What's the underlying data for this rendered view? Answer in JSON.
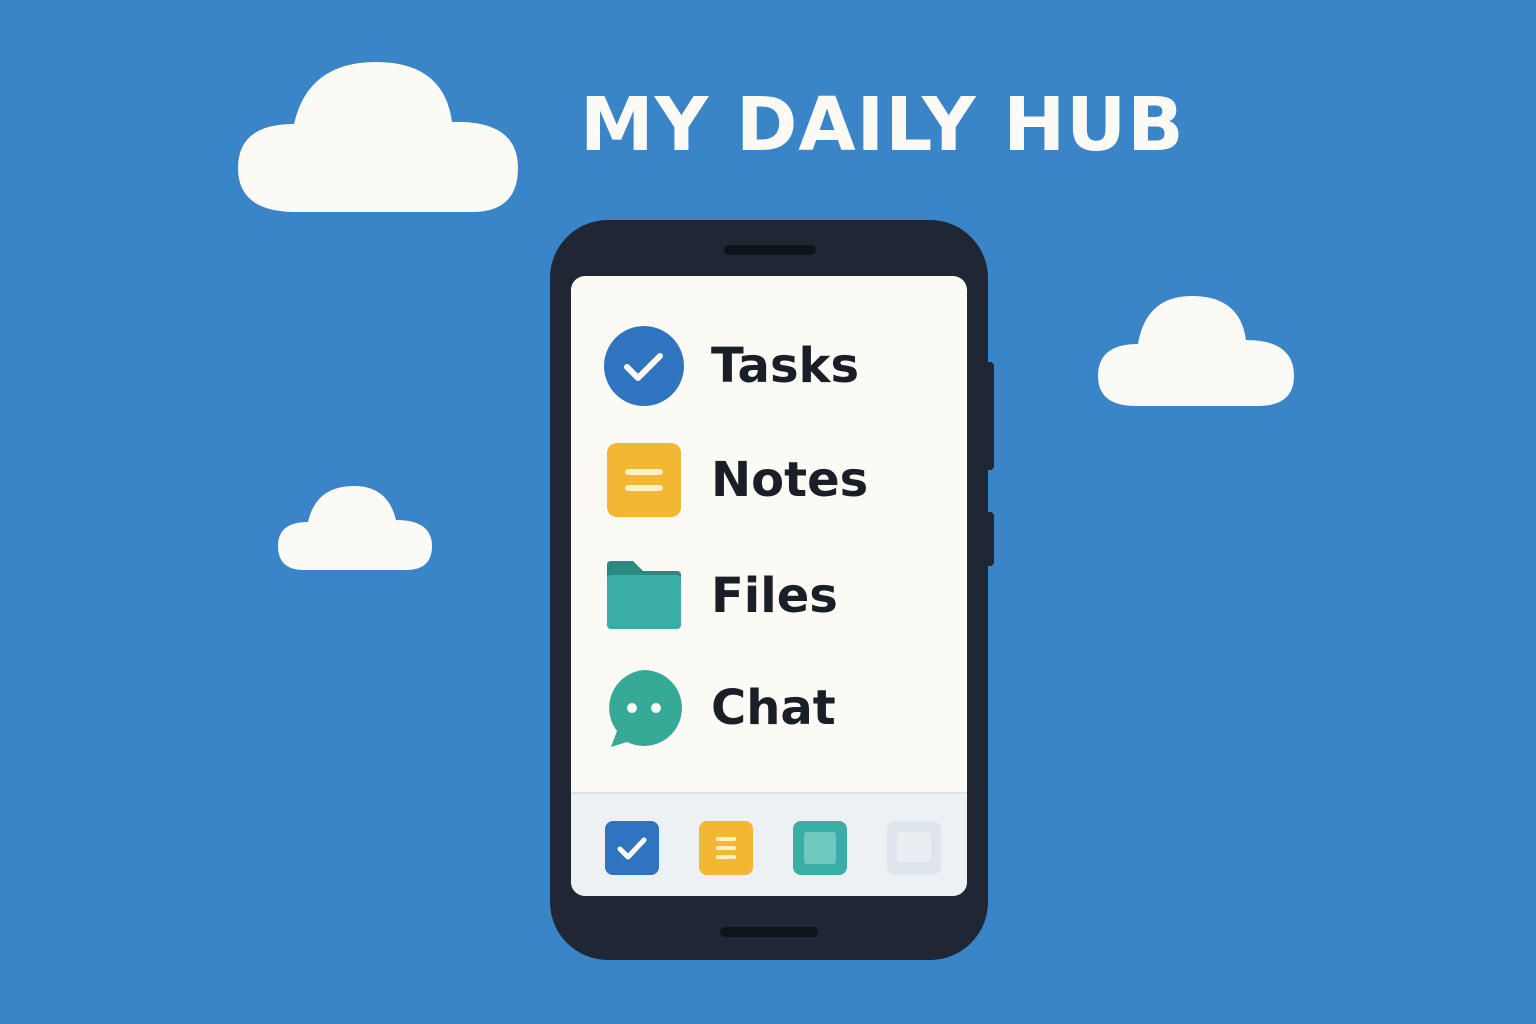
{
  "header": {
    "title": "MY DAILY HUB"
  },
  "apps": [
    {
      "label": "Tasks",
      "icon": "check-circle-icon",
      "color": "#2f74bf"
    },
    {
      "label": "Notes",
      "icon": "note-icon",
      "color": "#f4b731"
    },
    {
      "label": "Files",
      "icon": "folder-icon",
      "color": "#3aada4"
    },
    {
      "label": "Chat",
      "icon": "chat-bubble-icon",
      "color": "#36a997"
    }
  ],
  "dock": [
    {
      "icon": "check-icon",
      "color": "#2f74bf"
    },
    {
      "icon": "note-icon",
      "color": "#f4b731"
    },
    {
      "icon": "square-icon",
      "color": "#3aada4"
    },
    {
      "icon": "square-icon",
      "color": "#e3e8ee"
    }
  ],
  "colors": {
    "background": "#3a84c8",
    "phone_body": "#1e2733",
    "screen": "#fbfaf5",
    "cloud": "#fbfaf4"
  }
}
